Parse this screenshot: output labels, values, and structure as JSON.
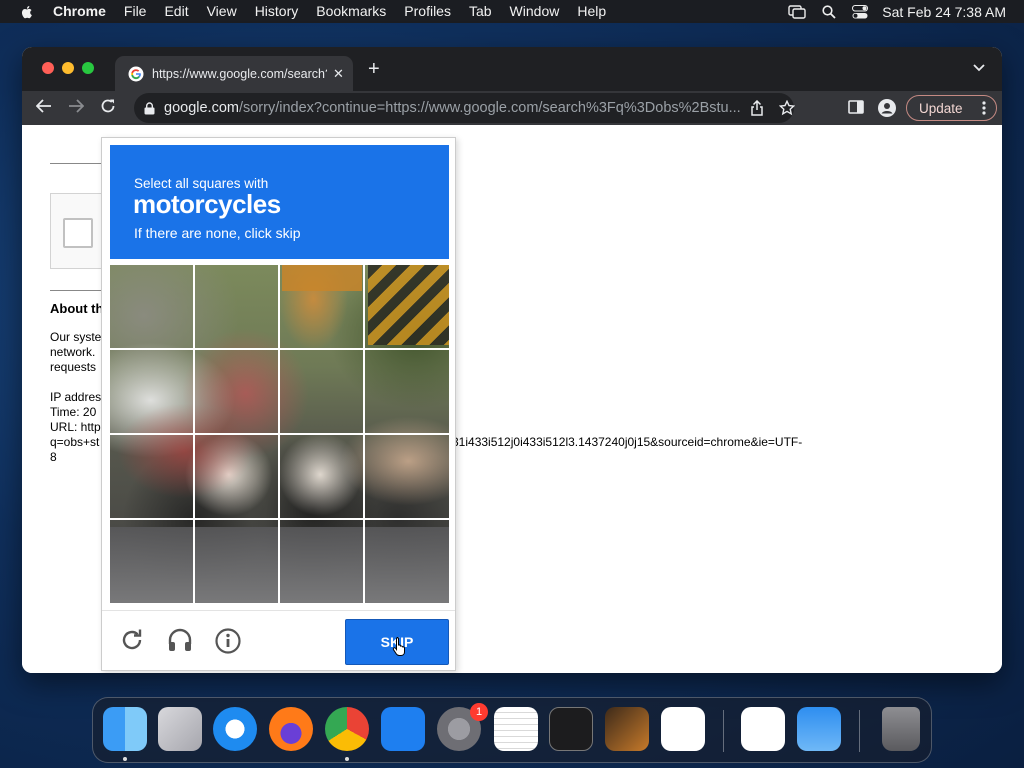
{
  "menubar": {
    "app": "Chrome",
    "items": [
      "File",
      "Edit",
      "View",
      "History",
      "Bookmarks",
      "Profiles",
      "Tab",
      "Window",
      "Help"
    ],
    "clock": "Sat Feb 24  7:38 AM"
  },
  "tab": {
    "title": "https://www.google.com/search?q=obs",
    "close": "✕",
    "new_tab": "+"
  },
  "omnibox": {
    "host": "google.com",
    "path": "/sorry/index?continue=https://www.google.com/search%3Fq%3Dobs%2Bstu..."
  },
  "toolbar": {
    "update_label": "Update"
  },
  "page": {
    "about_heading": "About th",
    "para1": "Our syste",
    "para2": "network.",
    "para3": "requests",
    "ip": "IP addres",
    "time": "Time: 20",
    "url_label": "URL: http",
    "q_line": "q=obs+st",
    "url_tail": "31i433i512j0i433i512l3.1437240j0j15&sourceid=chrome&ie=UTF-",
    "url_tail2": "8"
  },
  "captcha": {
    "line1": "Select all squares with",
    "target": "motorcycles",
    "line3": "If there are none, click skip",
    "skip_label": "SKIP",
    "grid_rows": 4,
    "grid_cols": 4
  },
  "dock": {
    "apps": [
      "finder-icon",
      "launchpad-icon",
      "safari-icon",
      "firefox-icon",
      "chrome-icon",
      "app-store-icon",
      "system-settings-icon",
      "textedit-icon",
      "terminal-icon",
      "garageband-icon",
      "vscode-icon",
      "visual-studio-icon",
      "weather-icon",
      "trash-icon"
    ],
    "settings_badge": "1"
  },
  "colors": {
    "captcha_blue": "#1a73e8",
    "chrome_dark": "#35363a"
  }
}
